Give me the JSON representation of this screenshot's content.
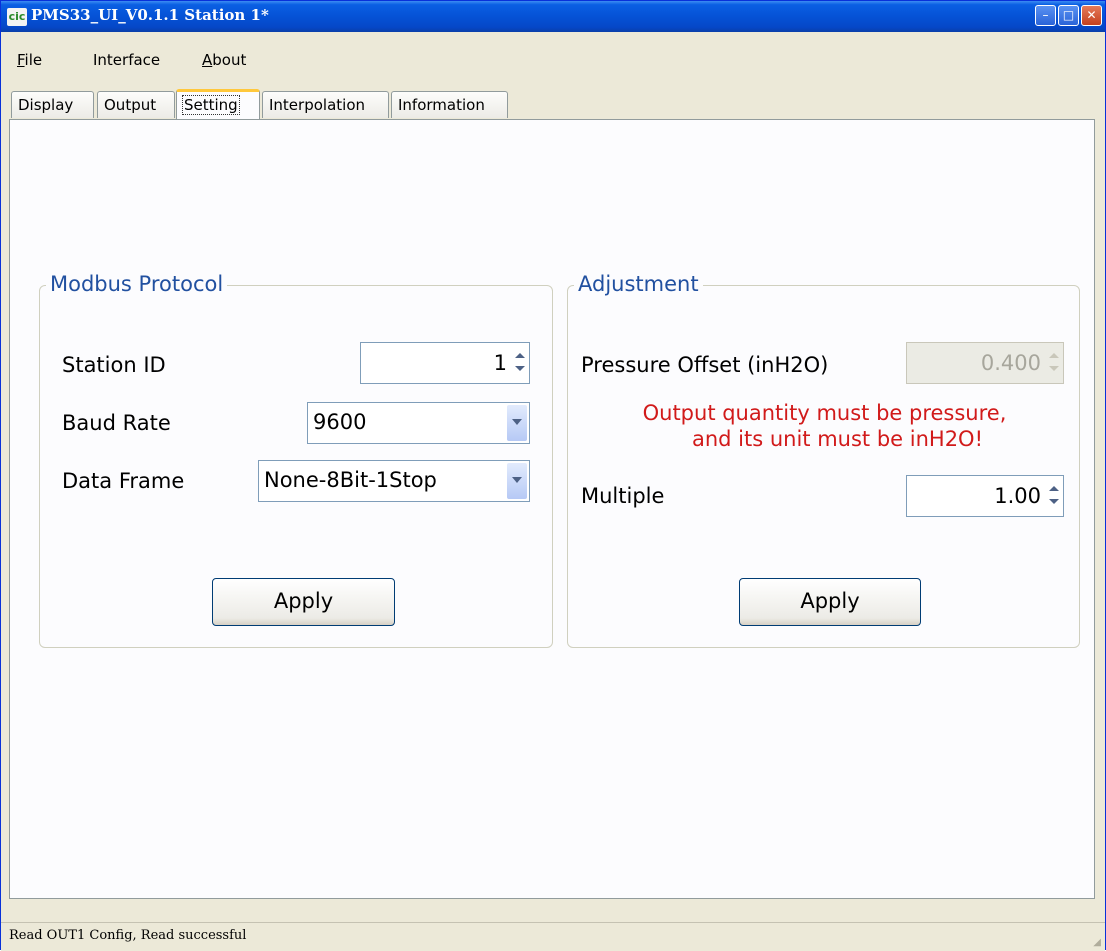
{
  "window": {
    "icon_text": "cic",
    "title": "PMS33_UI_V0.1.1  Station 1*",
    "controls": {
      "minimize": "–",
      "maximize": "□",
      "close": "✕"
    }
  },
  "menu": {
    "file": {
      "accel": "F",
      "rest": "ile"
    },
    "interface": {
      "accel": "",
      "rest": "Interface"
    },
    "about": {
      "accel": "A",
      "rest": "bout"
    }
  },
  "tabs": [
    {
      "label": "Display"
    },
    {
      "label": "Output"
    },
    {
      "label": "Setting",
      "active": true
    },
    {
      "label": "Interpolation"
    },
    {
      "label": "Information"
    }
  ],
  "modbus": {
    "title": "Modbus Protocol",
    "station_id_label": "Station ID",
    "station_id_value": "1",
    "baud_rate_label": "Baud Rate",
    "baud_rate_value": "9600",
    "data_frame_label": "Data Frame",
    "data_frame_value": "None-8Bit-1Stop",
    "apply_label": "Apply"
  },
  "adjustment": {
    "title": "Adjustment",
    "pressure_offset_label": "Pressure Offset  (inH2O)",
    "pressure_offset_value": "0.400",
    "warning_line1": "Output quantity must be pressure,",
    "warning_line2": "and its unit must be inH2O!",
    "multiple_label": "Multiple",
    "multiple_value": "1.00",
    "apply_label": "Apply"
  },
  "status": {
    "text": "Read OUT1 Config,  Read successful"
  },
  "colors": {
    "title_bar": "#0552d6",
    "group_title": "#2150a0",
    "warning": "#d11a1a",
    "active_tab_accent": "#ffc83c"
  }
}
